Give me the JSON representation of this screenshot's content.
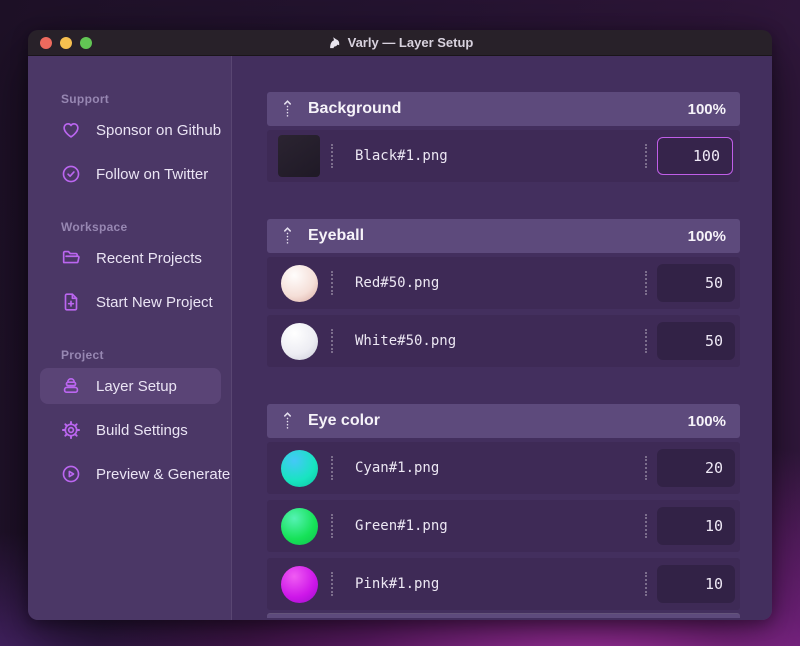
{
  "window": {
    "title": "Varly — Layer Setup",
    "app_icon": "unicorn-icon"
  },
  "titlebar": {
    "buttons": [
      {
        "name": "close",
        "color": "#ed6a5e"
      },
      {
        "name": "minimize",
        "color": "#f5bf4f"
      },
      {
        "name": "zoom",
        "color": "#62c554"
      }
    ]
  },
  "sidebar": {
    "sections": [
      {
        "heading": "Support",
        "items": [
          {
            "icon": "heart-icon",
            "label": "Sponsor on Github"
          },
          {
            "icon": "verified-badge-icon",
            "label": "Follow on Twitter"
          }
        ]
      },
      {
        "heading": "Workspace",
        "items": [
          {
            "icon": "folder-open-icon",
            "label": "Recent Projects"
          },
          {
            "icon": "file-plus-icon",
            "label": "Start New Project"
          }
        ]
      },
      {
        "heading": "Project",
        "items": [
          {
            "icon": "layers-icon",
            "label": "Layer Setup",
            "selected": true
          },
          {
            "icon": "gear-icon",
            "label": "Build Settings"
          },
          {
            "icon": "play-circle-icon",
            "label": "Preview & Generate"
          }
        ]
      }
    ]
  },
  "main": {
    "groups": [
      {
        "name": "Background",
        "weight": "100%",
        "rows": [
          {
            "file": "Black#1.png",
            "value": "100",
            "thumb": "black-square",
            "focused": true
          }
        ]
      },
      {
        "name": "Eyeball",
        "weight": "100%",
        "rows": [
          {
            "file": "Red#50.png",
            "value": "50",
            "thumb": "red-ball"
          },
          {
            "file": "White#50.png",
            "value": "50",
            "thumb": "white-ball"
          }
        ]
      },
      {
        "name": "Eye color",
        "weight": "100%",
        "rows": [
          {
            "file": "Cyan#1.png",
            "value": "20",
            "thumb": "cyan-ball"
          },
          {
            "file": "Green#1.png",
            "value": "10",
            "thumb": "green-ball"
          },
          {
            "file": "Pink#1.png",
            "value": "10",
            "thumb": "pink-ball"
          }
        ]
      }
    ]
  },
  "thumbs": {
    "black-square": {
      "shape": "square",
      "colors": [
        "#2b2431",
        "#1f1926"
      ]
    },
    "red-ball": {
      "shape": "ball",
      "colors": [
        "#fffdfc",
        "#f5dfd8",
        "#d8a9a0"
      ]
    },
    "white-ball": {
      "shape": "ball",
      "colors": [
        "#ffffff",
        "#ededf3",
        "#c9c9d6"
      ]
    },
    "cyan-ball": {
      "shape": "ball",
      "colors": [
        "#45c8f8",
        "#18e4c0",
        "#0cc2a2"
      ]
    },
    "green-ball": {
      "shape": "ball",
      "colors": [
        "#55f2b4",
        "#16e258",
        "#0fbf4e"
      ]
    },
    "pink-ball": {
      "shape": "ball",
      "colors": [
        "#f05cf3",
        "#ce17e9",
        "#9b0ccc"
      ]
    }
  },
  "colors": {
    "accent_icon": "#bb66f0",
    "focus_border": "#c05ee8",
    "group_header_bg": "#5d4a7c",
    "row_bg": "#3e2a56",
    "sidebar_bg": "#4b3766",
    "main_bg": "#432f5e",
    "titlebar_bg": "#282129",
    "selected_item_bg": "#5a4476",
    "desktop_magenta": "#b03ab3"
  }
}
